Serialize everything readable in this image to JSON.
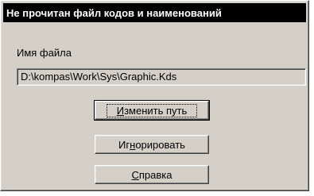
{
  "dialog": {
    "title": "Не прочитан файл кодов и наименований",
    "field_label": "Имя файла",
    "file_path": "D:\\kompas\\Work\\Sys\\Graphic.Kds",
    "buttons": {
      "change_path": {
        "mnemonic": "И",
        "rest": "зменить путь"
      },
      "ignore": {
        "before": "Иг",
        "mnemonic": "н",
        "rest": "орировать"
      },
      "help": {
        "mnemonic": "С",
        "rest": "правка"
      }
    }
  }
}
